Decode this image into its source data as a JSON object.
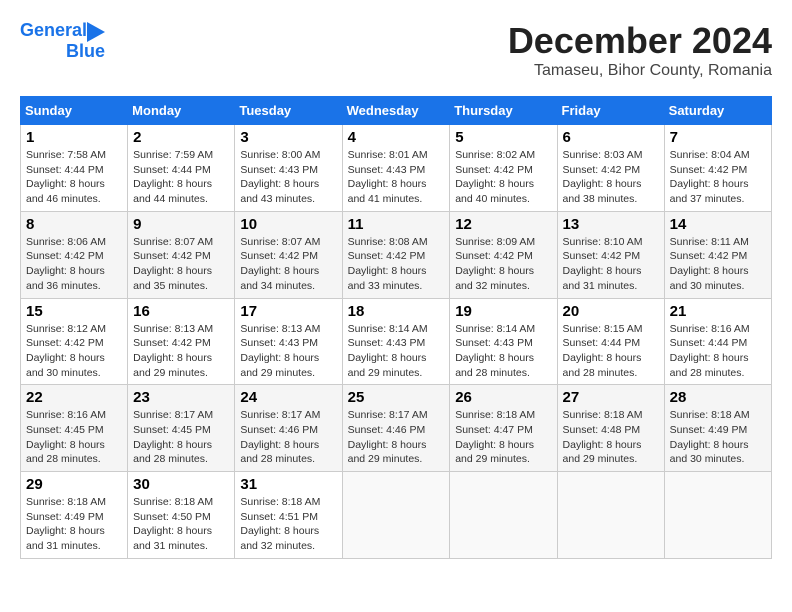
{
  "logo": {
    "line1": "General",
    "line2": "Blue"
  },
  "title": "December 2024",
  "subtitle": "Tamaseu, Bihor County, Romania",
  "weekdays": [
    "Sunday",
    "Monday",
    "Tuesday",
    "Wednesday",
    "Thursday",
    "Friday",
    "Saturday"
  ],
  "weeks": [
    [
      {
        "day": "1",
        "sunrise": "7:58 AM",
        "sunset": "4:44 PM",
        "daylight": "8 hours and 46 minutes."
      },
      {
        "day": "2",
        "sunrise": "7:59 AM",
        "sunset": "4:44 PM",
        "daylight": "8 hours and 44 minutes."
      },
      {
        "day": "3",
        "sunrise": "8:00 AM",
        "sunset": "4:43 PM",
        "daylight": "8 hours and 43 minutes."
      },
      {
        "day": "4",
        "sunrise": "8:01 AM",
        "sunset": "4:43 PM",
        "daylight": "8 hours and 41 minutes."
      },
      {
        "day": "5",
        "sunrise": "8:02 AM",
        "sunset": "4:42 PM",
        "daylight": "8 hours and 40 minutes."
      },
      {
        "day": "6",
        "sunrise": "8:03 AM",
        "sunset": "4:42 PM",
        "daylight": "8 hours and 38 minutes."
      },
      {
        "day": "7",
        "sunrise": "8:04 AM",
        "sunset": "4:42 PM",
        "daylight": "8 hours and 37 minutes."
      }
    ],
    [
      {
        "day": "8",
        "sunrise": "8:06 AM",
        "sunset": "4:42 PM",
        "daylight": "8 hours and 36 minutes."
      },
      {
        "day": "9",
        "sunrise": "8:07 AM",
        "sunset": "4:42 PM",
        "daylight": "8 hours and 35 minutes."
      },
      {
        "day": "10",
        "sunrise": "8:07 AM",
        "sunset": "4:42 PM",
        "daylight": "8 hours and 34 minutes."
      },
      {
        "day": "11",
        "sunrise": "8:08 AM",
        "sunset": "4:42 PM",
        "daylight": "8 hours and 33 minutes."
      },
      {
        "day": "12",
        "sunrise": "8:09 AM",
        "sunset": "4:42 PM",
        "daylight": "8 hours and 32 minutes."
      },
      {
        "day": "13",
        "sunrise": "8:10 AM",
        "sunset": "4:42 PM",
        "daylight": "8 hours and 31 minutes."
      },
      {
        "day": "14",
        "sunrise": "8:11 AM",
        "sunset": "4:42 PM",
        "daylight": "8 hours and 30 minutes."
      }
    ],
    [
      {
        "day": "15",
        "sunrise": "8:12 AM",
        "sunset": "4:42 PM",
        "daylight": "8 hours and 30 minutes."
      },
      {
        "day": "16",
        "sunrise": "8:13 AM",
        "sunset": "4:42 PM",
        "daylight": "8 hours and 29 minutes."
      },
      {
        "day": "17",
        "sunrise": "8:13 AM",
        "sunset": "4:43 PM",
        "daylight": "8 hours and 29 minutes."
      },
      {
        "day": "18",
        "sunrise": "8:14 AM",
        "sunset": "4:43 PM",
        "daylight": "8 hours and 29 minutes."
      },
      {
        "day": "19",
        "sunrise": "8:14 AM",
        "sunset": "4:43 PM",
        "daylight": "8 hours and 28 minutes."
      },
      {
        "day": "20",
        "sunrise": "8:15 AM",
        "sunset": "4:44 PM",
        "daylight": "8 hours and 28 minutes."
      },
      {
        "day": "21",
        "sunrise": "8:16 AM",
        "sunset": "4:44 PM",
        "daylight": "8 hours and 28 minutes."
      }
    ],
    [
      {
        "day": "22",
        "sunrise": "8:16 AM",
        "sunset": "4:45 PM",
        "daylight": "8 hours and 28 minutes."
      },
      {
        "day": "23",
        "sunrise": "8:17 AM",
        "sunset": "4:45 PM",
        "daylight": "8 hours and 28 minutes."
      },
      {
        "day": "24",
        "sunrise": "8:17 AM",
        "sunset": "4:46 PM",
        "daylight": "8 hours and 28 minutes."
      },
      {
        "day": "25",
        "sunrise": "8:17 AM",
        "sunset": "4:46 PM",
        "daylight": "8 hours and 29 minutes."
      },
      {
        "day": "26",
        "sunrise": "8:18 AM",
        "sunset": "4:47 PM",
        "daylight": "8 hours and 29 minutes."
      },
      {
        "day": "27",
        "sunrise": "8:18 AM",
        "sunset": "4:48 PM",
        "daylight": "8 hours and 29 minutes."
      },
      {
        "day": "28",
        "sunrise": "8:18 AM",
        "sunset": "4:49 PM",
        "daylight": "8 hours and 30 minutes."
      }
    ],
    [
      {
        "day": "29",
        "sunrise": "8:18 AM",
        "sunset": "4:49 PM",
        "daylight": "8 hours and 31 minutes."
      },
      {
        "day": "30",
        "sunrise": "8:18 AM",
        "sunset": "4:50 PM",
        "daylight": "8 hours and 31 minutes."
      },
      {
        "day": "31",
        "sunrise": "8:18 AM",
        "sunset": "4:51 PM",
        "daylight": "8 hours and 32 minutes."
      },
      null,
      null,
      null,
      null
    ]
  ]
}
